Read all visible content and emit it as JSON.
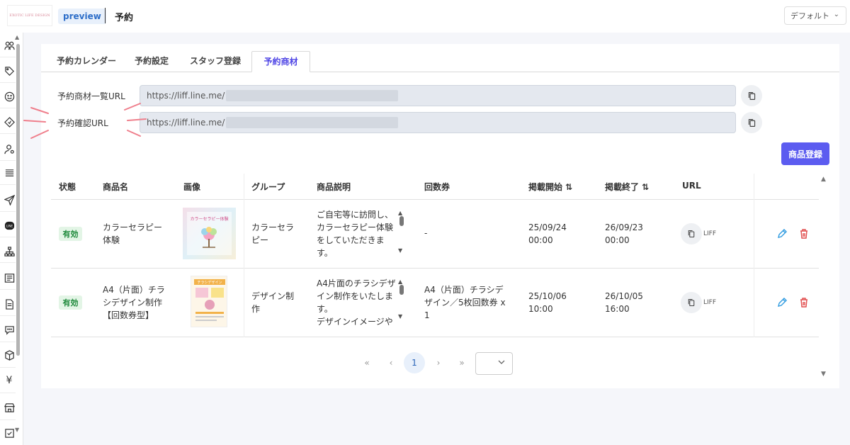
{
  "header": {
    "logo_text": "EXOTIC LIFE DESIGN",
    "preview_label": "preview",
    "title": "予約",
    "view_select": "デフォルト"
  },
  "sidebar": {
    "icons": [
      "users-icon",
      "tag-icon",
      "smile-icon",
      "ticket-icon",
      "user-settings-icon",
      "list-icon",
      "send-icon",
      "line-icon",
      "hierarchy-icon",
      "news-icon",
      "document-icon",
      "chat-icon",
      "box-icon",
      "yen-icon",
      "store-icon",
      "checklist-icon"
    ]
  },
  "tabs": [
    {
      "label": "予約カレンダー",
      "active": false
    },
    {
      "label": "予約設定",
      "active": false
    },
    {
      "label": "スタッフ登録",
      "active": false
    },
    {
      "label": "予約商材",
      "active": true
    }
  ],
  "urls": {
    "list_label": "予約商材一覧URL",
    "list_value": "https://liff.line.me/",
    "confirm_label": "予約確認URL",
    "confirm_value": "https://liff.line.me/"
  },
  "register_button": "商品登録",
  "table": {
    "headers": [
      "状態",
      "商品名",
      "画像",
      "グループ",
      "商品説明",
      "回数券",
      "掲載開始 ⇅",
      "掲載終了 ⇅",
      "URL"
    ],
    "rows": [
      {
        "status": "有効",
        "name": [
          "カラーセラピー",
          "体験"
        ],
        "image_caption": "カラーセラピー体験",
        "group": [
          "カラーセラ",
          "ピー"
        ],
        "description": [
          "ご自宅等に訪問し、",
          "カラーセラピー体験",
          "をしていただきま",
          "す。"
        ],
        "coupon": [
          "-"
        ],
        "start": [
          "25/09/24",
          "00:00"
        ],
        "end": [
          "26/09/23",
          "00:00"
        ],
        "url_label": "LIFF"
      },
      {
        "status": "有効",
        "name": [
          "A4（片面）チラ",
          "シデザイン制作",
          "【回数券型】"
        ],
        "image_caption": "チラシデザイン",
        "group": [
          "デザイン制",
          "作"
        ],
        "description": [
          "A4片面のチラシデザ",
          "イン制作をいたしま",
          "す。",
          "デザインイメージや"
        ],
        "coupon": [
          "A4（片面）チラシデ",
          "ザイン／5枚回数券 x",
          "1"
        ],
        "start": [
          "25/10/06",
          "10:00"
        ],
        "end": [
          "26/10/05",
          "16:00"
        ],
        "url_label": "LIFF"
      }
    ]
  },
  "pagination": {
    "first": "«",
    "prev": "‹",
    "current": "1",
    "next": "›",
    "last": "»"
  },
  "colors": {
    "accent": "#5c5cf0",
    "active_tab": "#5046e5",
    "status_green": "#1f8a3c",
    "edit_blue": "#2f9be0",
    "delete_red": "#e14b4b",
    "annotation": "#ef7f8c"
  }
}
